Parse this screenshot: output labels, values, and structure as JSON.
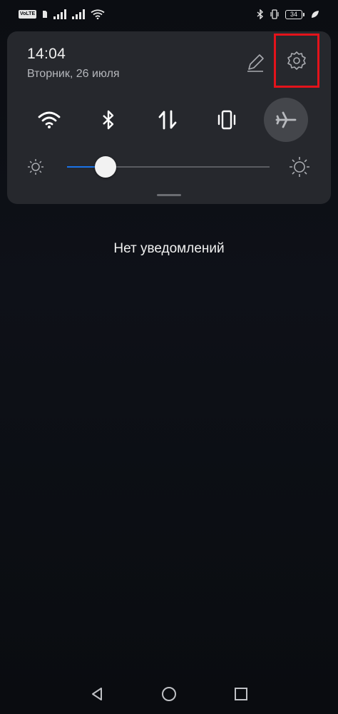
{
  "status_bar": {
    "volte_label": "VoLTE",
    "battery_level": "34",
    "icons": [
      "volte-icon",
      "sim-icon",
      "signal-icon",
      "signal-icon",
      "wifi-icon",
      "bluetooth-icon",
      "vibrate-icon",
      "battery-icon",
      "leaf-icon"
    ]
  },
  "quick_panel": {
    "time": "14:04",
    "date": "Вторник, 26 июля",
    "edit_icon": "pencil-icon",
    "settings_icon": "gear-icon",
    "toggles": [
      {
        "icon": "wifi-icon",
        "state": "on"
      },
      {
        "icon": "bluetooth-icon",
        "state": "on"
      },
      {
        "icon": "mobile-data-icon",
        "state": "on"
      },
      {
        "icon": "vibrate-icon",
        "state": "on"
      },
      {
        "icon": "airplane-icon",
        "state": "off"
      }
    ],
    "brightness_fraction": 0.19
  },
  "notifications": {
    "empty_text": "Нет уведомлений"
  },
  "colors": {
    "accent": "#1a73e8",
    "highlight": "#e3131b",
    "panel": "#26282d"
  }
}
